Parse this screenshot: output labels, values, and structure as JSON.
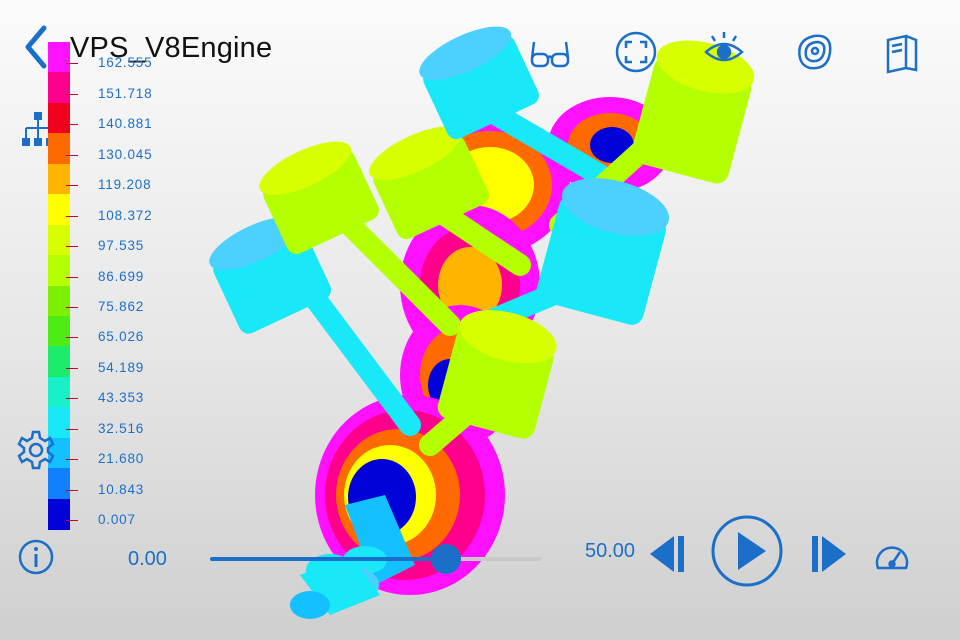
{
  "header": {
    "title": "VPS_V8Engine"
  },
  "toolbar": {
    "icons": [
      "glasses-icon",
      "fit-view-icon",
      "visibility-eye-icon",
      "contour-icon",
      "book-icon"
    ]
  },
  "legend": {
    "colors": [
      "#ff10ff",
      "#ff008c",
      "#f0001c",
      "#ff6a00",
      "#ffb400",
      "#ffff00",
      "#d8ff00",
      "#b4ff00",
      "#7cf000",
      "#4cec14",
      "#1cec6c",
      "#18f0c8",
      "#18e8f8",
      "#14c0ff",
      "#1080ff",
      "#0000d8"
    ],
    "labels": [
      "162.555",
      "151.718",
      "140.881",
      "130.045",
      "119.208",
      "108.372",
      "97.535",
      "86.699",
      "75.862",
      "65.026",
      "54.189",
      "43.353",
      "32.516",
      "21.680",
      "10.843",
      "0.007"
    ]
  },
  "playback": {
    "start_time": "0.00",
    "current_time": "50.00",
    "progress": 0.71
  },
  "colors": {
    "accent": "#1c6fc9"
  }
}
